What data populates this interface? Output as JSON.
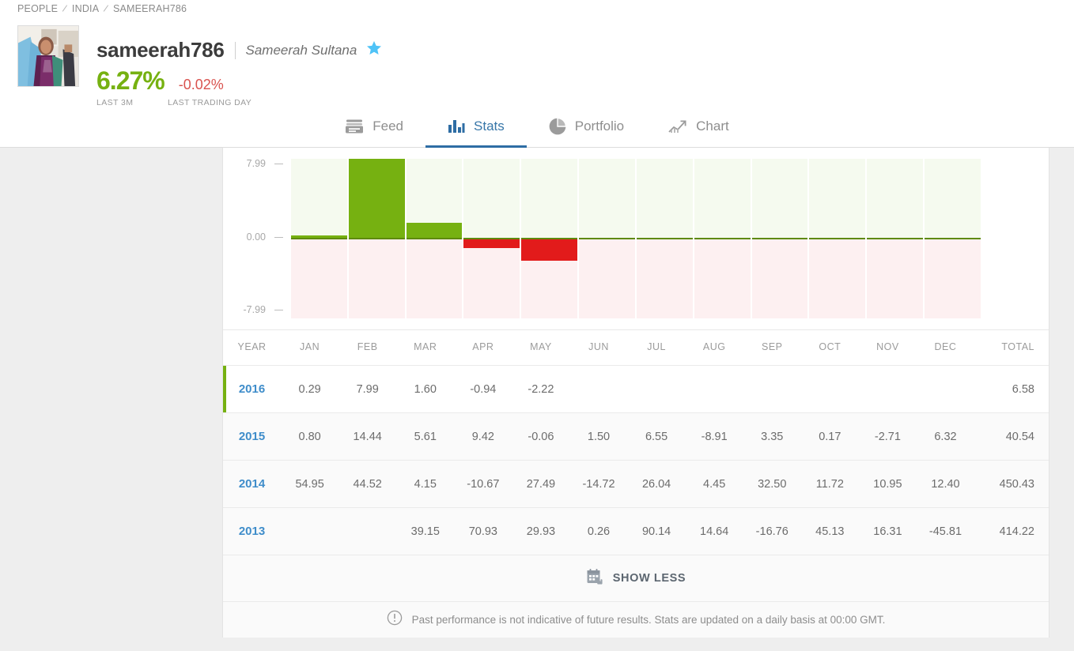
{
  "breadcrumb": {
    "items": [
      "PEOPLE",
      "INDIA",
      "SAMEERAH786"
    ],
    "separator": "/"
  },
  "profile": {
    "username": "sameerah786",
    "real_name": "Sameerah Sultana",
    "verified_icon": "star-icon",
    "performance_pct": "6.27%",
    "performance_label": "LAST 3M",
    "daily_pct": "-0.02%",
    "daily_label": "LAST TRADING DAY",
    "avatar_icon": "user-photo-avatar"
  },
  "tabs": [
    {
      "label": "Feed",
      "icon": "feed-icon",
      "active": false
    },
    {
      "label": "Stats",
      "icon": "bar-chart-icon",
      "active": true
    },
    {
      "label": "Portfolio",
      "icon": "pie-chart-icon",
      "active": false
    },
    {
      "label": "Chart",
      "icon": "line-chart-icon",
      "active": false
    }
  ],
  "chart_data": {
    "type": "bar",
    "title": "",
    "xlabel": "",
    "ylabel": "",
    "categories": [
      "JAN",
      "FEB",
      "MAR",
      "APR",
      "MAY",
      "JUN",
      "JUL",
      "AUG",
      "SEP",
      "OCT",
      "NOV",
      "DEC"
    ],
    "values": [
      0.29,
      7.99,
      1.6,
      -0.94,
      -2.22,
      null,
      null,
      null,
      null,
      null,
      null,
      null
    ],
    "ylim": [
      -7.99,
      7.99
    ],
    "ytick_labels": [
      "7.99",
      "0.00",
      "-7.99"
    ],
    "ytick_values": [
      7.99,
      0.0,
      -7.99
    ],
    "grid": false,
    "legend": "none",
    "positive_color": "#76b111",
    "negative_color": "#e21b1b",
    "positive_band_color": "#f5faef",
    "negative_band_color": "#fdf0f1",
    "zero_line_color": "#5e8a0e"
  },
  "table": {
    "headers": [
      "YEAR",
      "JAN",
      "FEB",
      "MAR",
      "APR",
      "MAY",
      "JUN",
      "JUL",
      "AUG",
      "SEP",
      "OCT",
      "NOV",
      "DEC",
      "TOTAL"
    ],
    "rows": [
      {
        "year": "2016",
        "current": true,
        "months": [
          "0.29",
          "7.99",
          "1.60",
          "-0.94",
          "-2.22",
          "",
          "",
          "",
          "",
          "",
          "",
          ""
        ],
        "total": "6.58"
      },
      {
        "year": "2015",
        "current": false,
        "months": [
          "0.80",
          "14.44",
          "5.61",
          "9.42",
          "-0.06",
          "1.50",
          "6.55",
          "-8.91",
          "3.35",
          "0.17",
          "-2.71",
          "6.32"
        ],
        "total": "40.54"
      },
      {
        "year": "2014",
        "current": false,
        "months": [
          "54.95",
          "44.52",
          "4.15",
          "-10.67",
          "27.49",
          "-14.72",
          "26.04",
          "4.45",
          "32.50",
          "11.72",
          "10.95",
          "12.40"
        ],
        "total": "450.43"
      },
      {
        "year": "2013",
        "current": false,
        "months": [
          "",
          "",
          "39.15",
          "70.93",
          "29.93",
          "0.26",
          "90.14",
          "14.64",
          "-16.76",
          "45.13",
          "16.31",
          "-45.81"
        ],
        "total": "414.22"
      }
    ]
  },
  "footer": {
    "show_less_label": "SHOW LESS",
    "show_less_icon": "calendar-collapse-icon",
    "disclaimer_icon": "exclamation-circle-icon",
    "disclaimer": "Past performance is not indicative of future results. Stats are updated on a daily basis at 00:00 GMT."
  },
  "colors": {
    "accent_green": "#76b111",
    "accent_red": "#e21b1b",
    "link_blue": "#3f8dca",
    "tab_active": "#2e6da4",
    "star_blue": "#4fc3f7"
  }
}
